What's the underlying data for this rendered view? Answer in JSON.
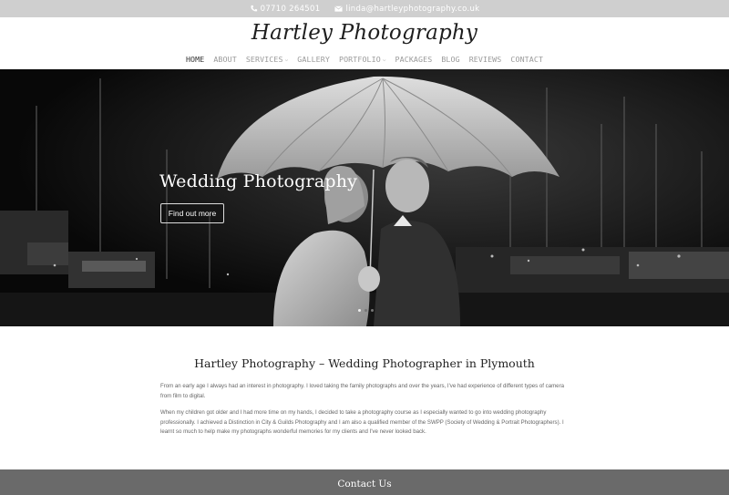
{
  "topbar": {
    "phone": "07710 264501",
    "email": "linda@hartleyphotography.co.uk"
  },
  "header": {
    "logo": "Hartley Photography"
  },
  "nav": {
    "items": [
      {
        "label": "Home"
      },
      {
        "label": "About"
      },
      {
        "label": "Services"
      },
      {
        "label": "Gallery"
      },
      {
        "label": "Portfolio"
      },
      {
        "label": "Packages"
      },
      {
        "label": "Blog"
      },
      {
        "label": "Reviews"
      },
      {
        "label": "Contact"
      }
    ]
  },
  "hero": {
    "title": "Wedding Photography",
    "button": "Find out more"
  },
  "content": {
    "heading": "Hartley Photography – Wedding Photographer in Plymouth",
    "para1": "From an early age I always had an interest in photography. I loved taking the family photographs and over the years, I've had experience of different types of camera from film to digital.",
    "para2": "When my children got older and I had more time on my hands, I decided to take a photography course as I especially wanted to go into wedding photography professionally. I achieved a Distinction in City & Guilds Photography and I am also a qualified member of the SWPP (Society of Wedding & Portrait Photographers). I learnt so much to help make my photographs wonderful memories for my clients and I've never looked back."
  },
  "footer": {
    "title": "Contact Us"
  }
}
